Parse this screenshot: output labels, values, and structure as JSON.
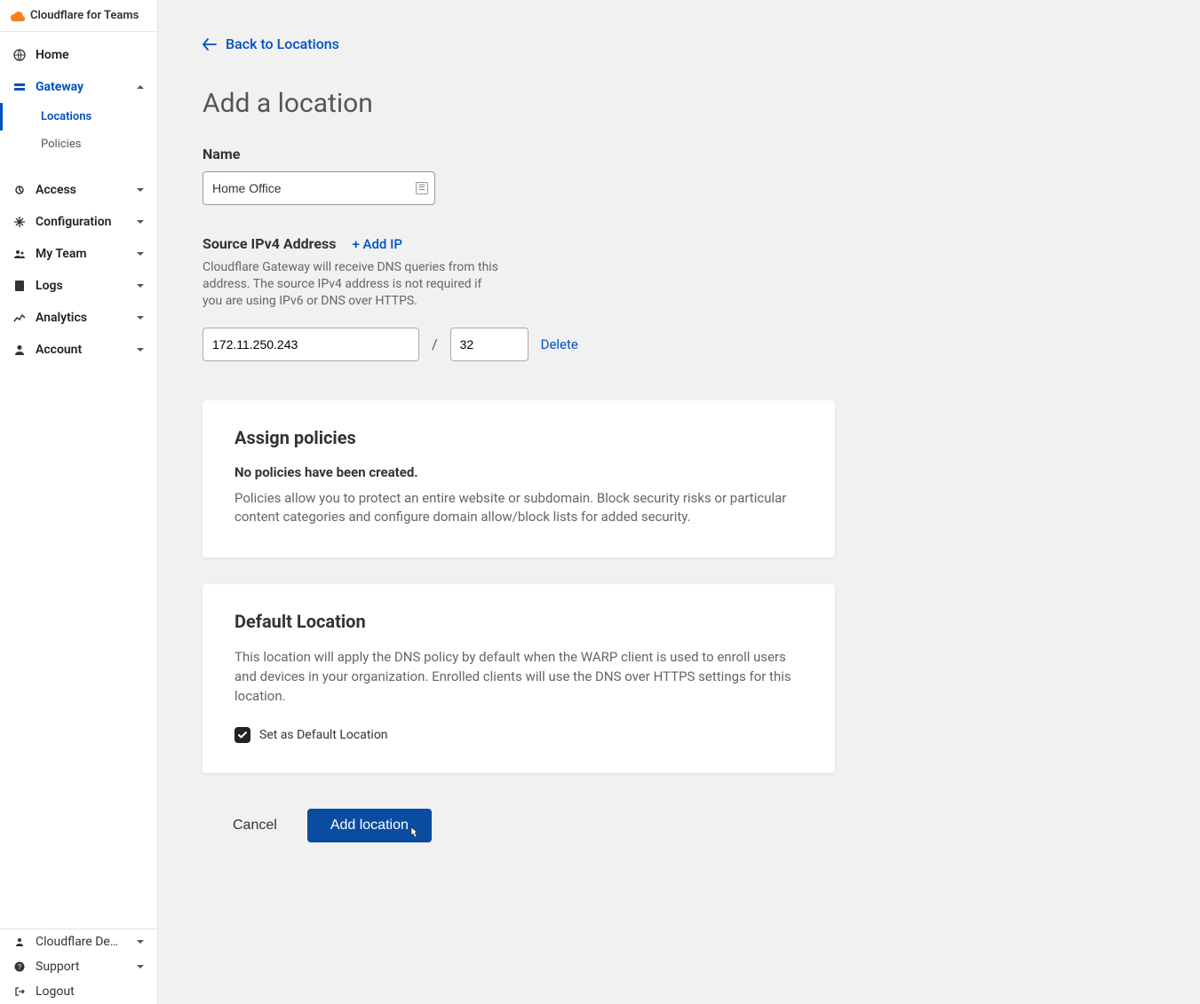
{
  "brand": {
    "title": "Cloudflare for Teams"
  },
  "sidebar": {
    "items": [
      {
        "label": "Home"
      },
      {
        "label": "Gateway"
      },
      {
        "label": "Access"
      },
      {
        "label": "Configuration"
      },
      {
        "label": "My Team"
      },
      {
        "label": "Logs"
      },
      {
        "label": "Analytics"
      },
      {
        "label": "Account"
      }
    ],
    "gateway_sub": [
      {
        "label": "Locations"
      },
      {
        "label": "Policies"
      }
    ],
    "footer": {
      "org": "Cloudflare Demo d…",
      "support": "Support",
      "logout": "Logout"
    }
  },
  "main": {
    "back": "Back to Locations",
    "title": "Add a location",
    "name_label": "Name",
    "name_value": "Home Office",
    "ipv4": {
      "label": "Source IPv4 Address",
      "add_ip": "+ Add IP",
      "help": "Cloudflare Gateway will receive DNS queries from this address. The source IPv4 address is not required if you are using IPv6 or DNS over HTTPS.",
      "ip_value": "172.11.250.243",
      "separator": "/",
      "mask_value": "32",
      "delete": "Delete"
    },
    "policies": {
      "title": "Assign policies",
      "sub": "No policies have been created.",
      "body": "Policies allow you to protect an entire website or subdomain. Block security risks or particular content categories and configure domain allow/block lists for added security."
    },
    "default": {
      "title": "Default Location",
      "body": "This location will apply the DNS policy by default when the WARP client is used to enroll users and devices in your organization. Enrolled clients will use the DNS over HTTPS settings for this location.",
      "check_label": "Set as Default Location",
      "checked": true
    },
    "actions": {
      "cancel": "Cancel",
      "submit": "Add location"
    }
  }
}
